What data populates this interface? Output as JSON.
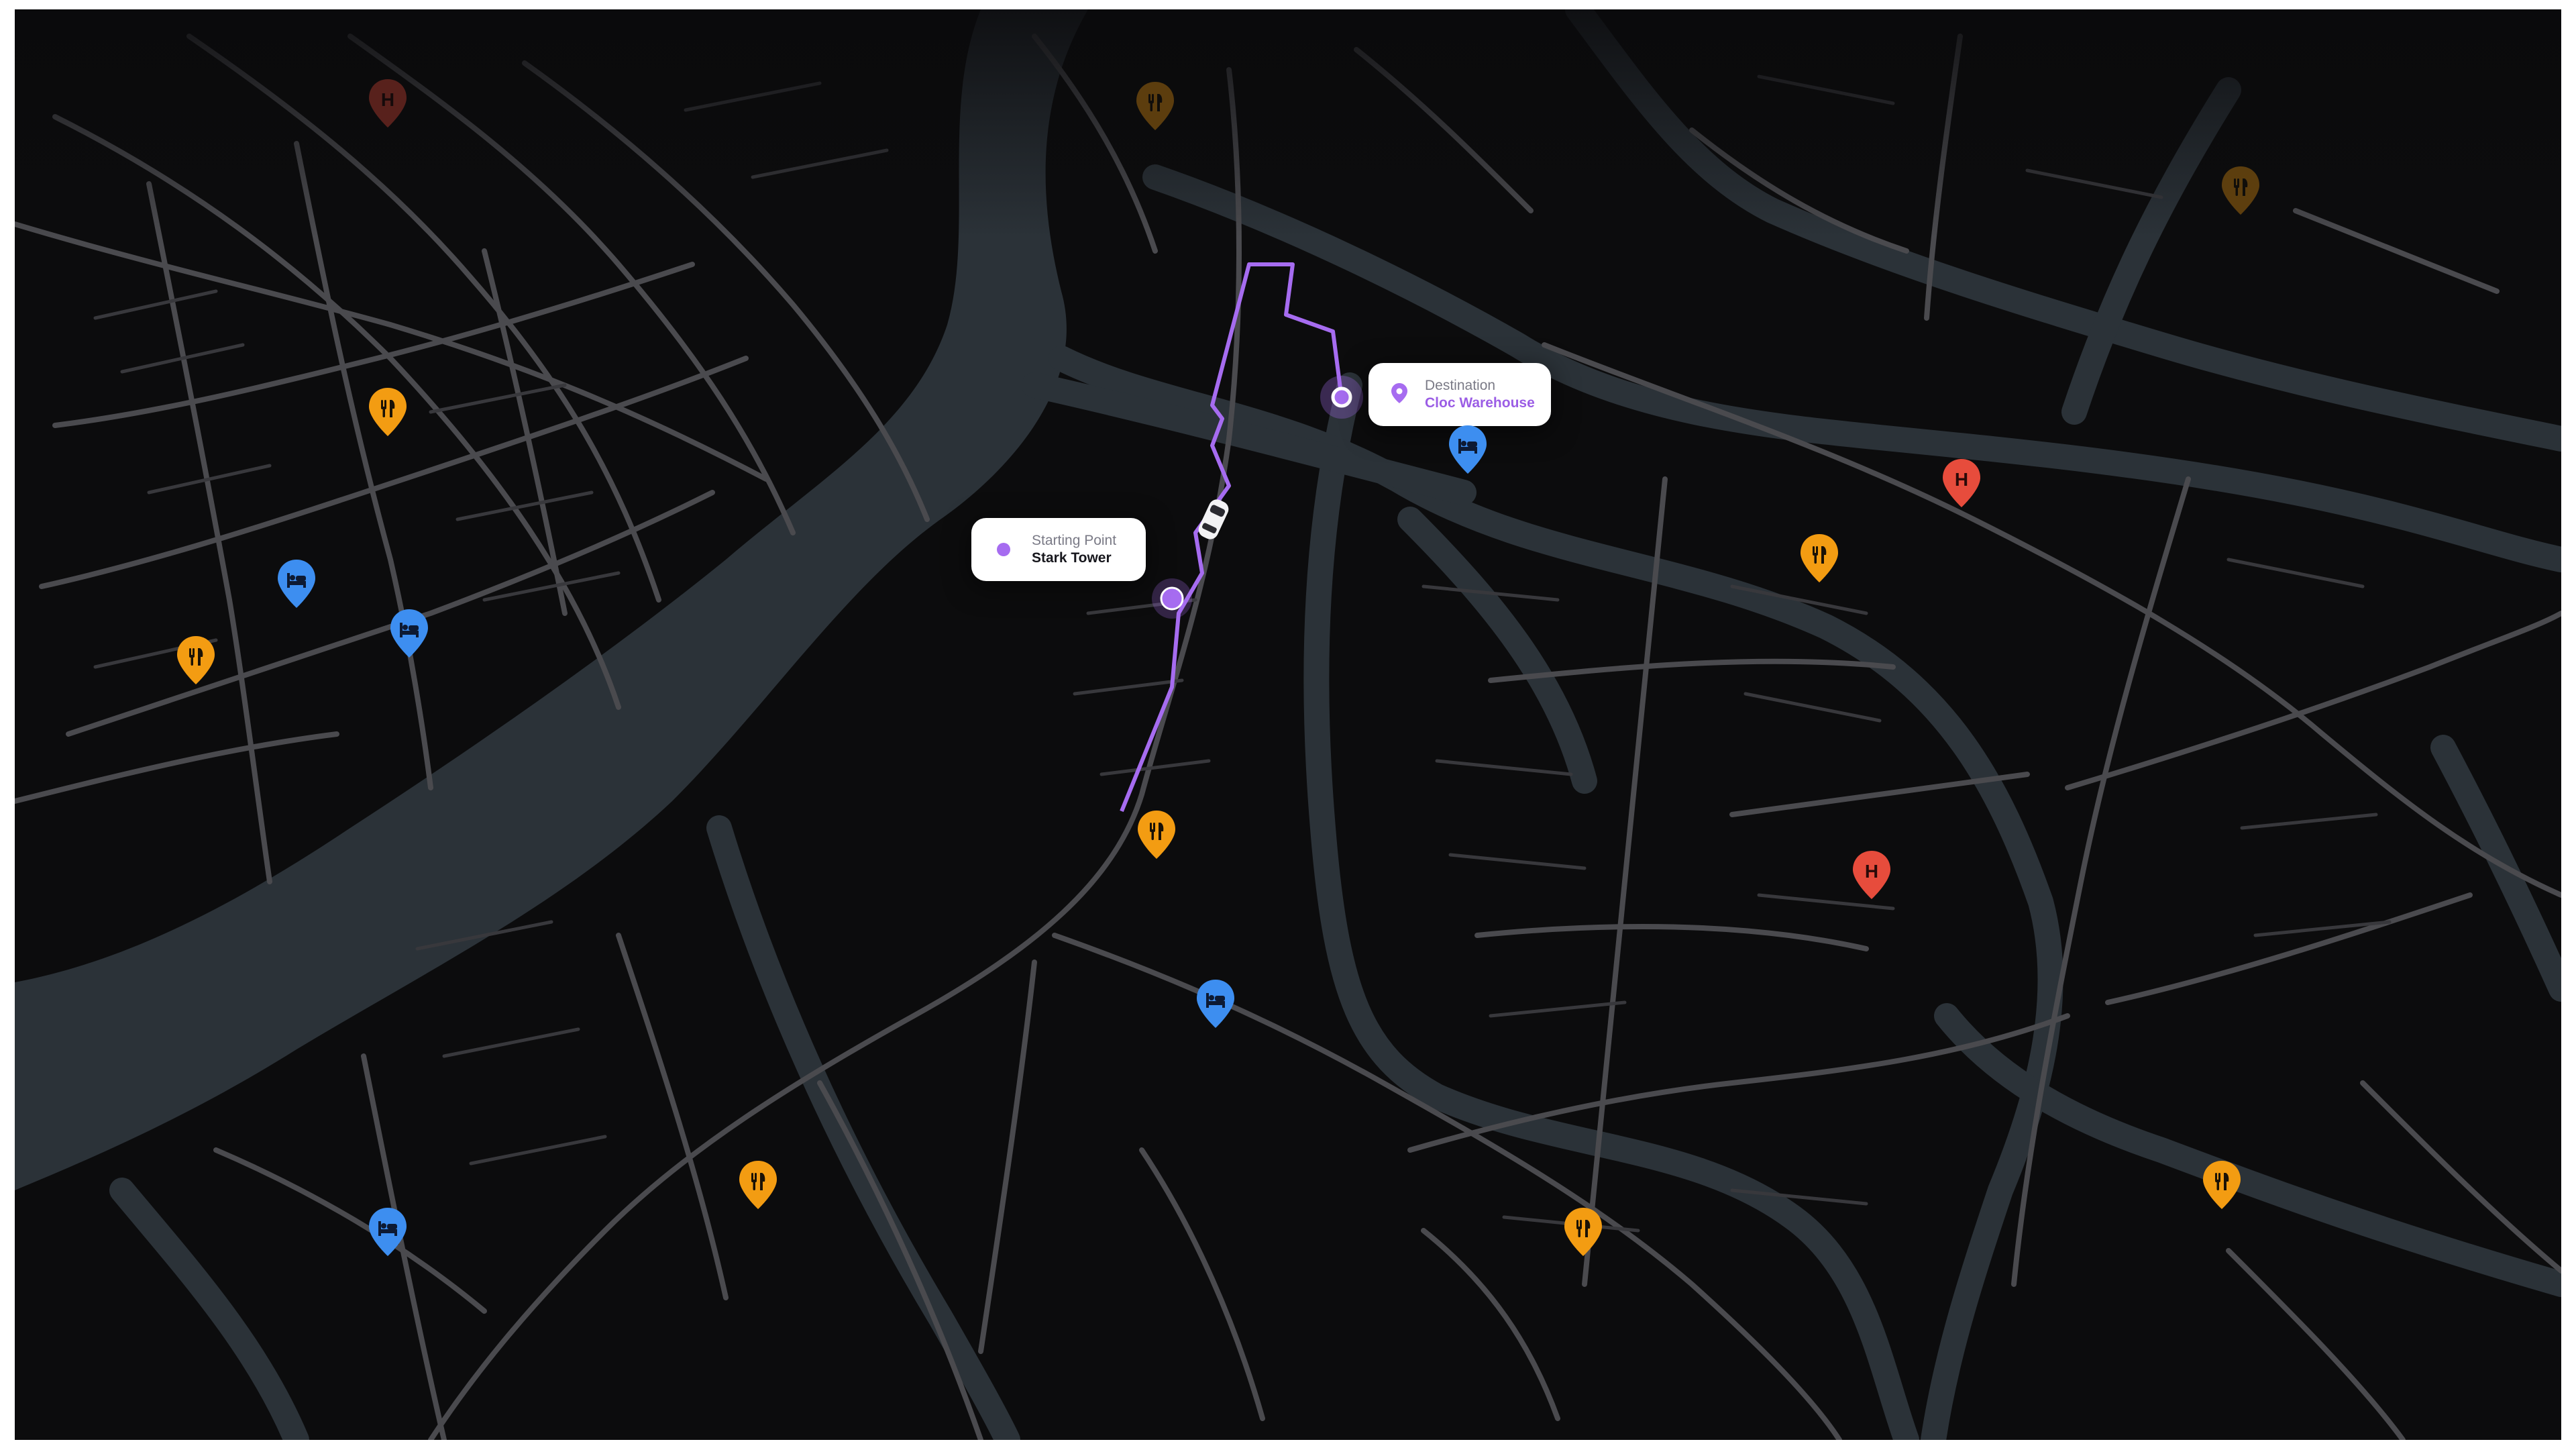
{
  "colors": {
    "background": "#0c0c0d",
    "river": "#2b3238",
    "street": "#4a4a4e",
    "route": "#a66cf0",
    "restaurant": "#f39c12",
    "hotel": "#3d8ef0",
    "hospital": "#e74c3c"
  },
  "route": {
    "start": {
      "label": "Starting Point",
      "name": "Stark Tower"
    },
    "destination": {
      "label": "Destination",
      "name": "Cloc Warehouse"
    }
  },
  "pois": [
    {
      "type": "hospital",
      "icon": "hospital-icon",
      "letter": "H",
      "faded": true
    },
    {
      "type": "restaurant",
      "icon": "fork-knife-icon",
      "faded": true
    },
    {
      "type": "restaurant",
      "icon": "fork-knife-icon",
      "faded": true
    },
    {
      "type": "restaurant",
      "icon": "fork-knife-icon"
    },
    {
      "type": "hotel",
      "icon": "bed-icon"
    },
    {
      "type": "hotel",
      "icon": "bed-icon"
    },
    {
      "type": "restaurant",
      "icon": "fork-knife-icon"
    },
    {
      "type": "hotel",
      "icon": "bed-icon"
    },
    {
      "type": "hospital",
      "icon": "hospital-icon",
      "letter": "H"
    },
    {
      "type": "restaurant",
      "icon": "fork-knife-icon"
    },
    {
      "type": "restaurant",
      "icon": "fork-knife-icon"
    },
    {
      "type": "hospital",
      "icon": "hospital-icon",
      "letter": "H"
    },
    {
      "type": "hotel",
      "icon": "bed-icon"
    },
    {
      "type": "restaurant",
      "icon": "fork-knife-icon"
    },
    {
      "type": "restaurant",
      "icon": "fork-knife-icon"
    },
    {
      "type": "restaurant",
      "icon": "fork-knife-icon"
    },
    {
      "type": "hotel",
      "icon": "bed-icon"
    }
  ]
}
